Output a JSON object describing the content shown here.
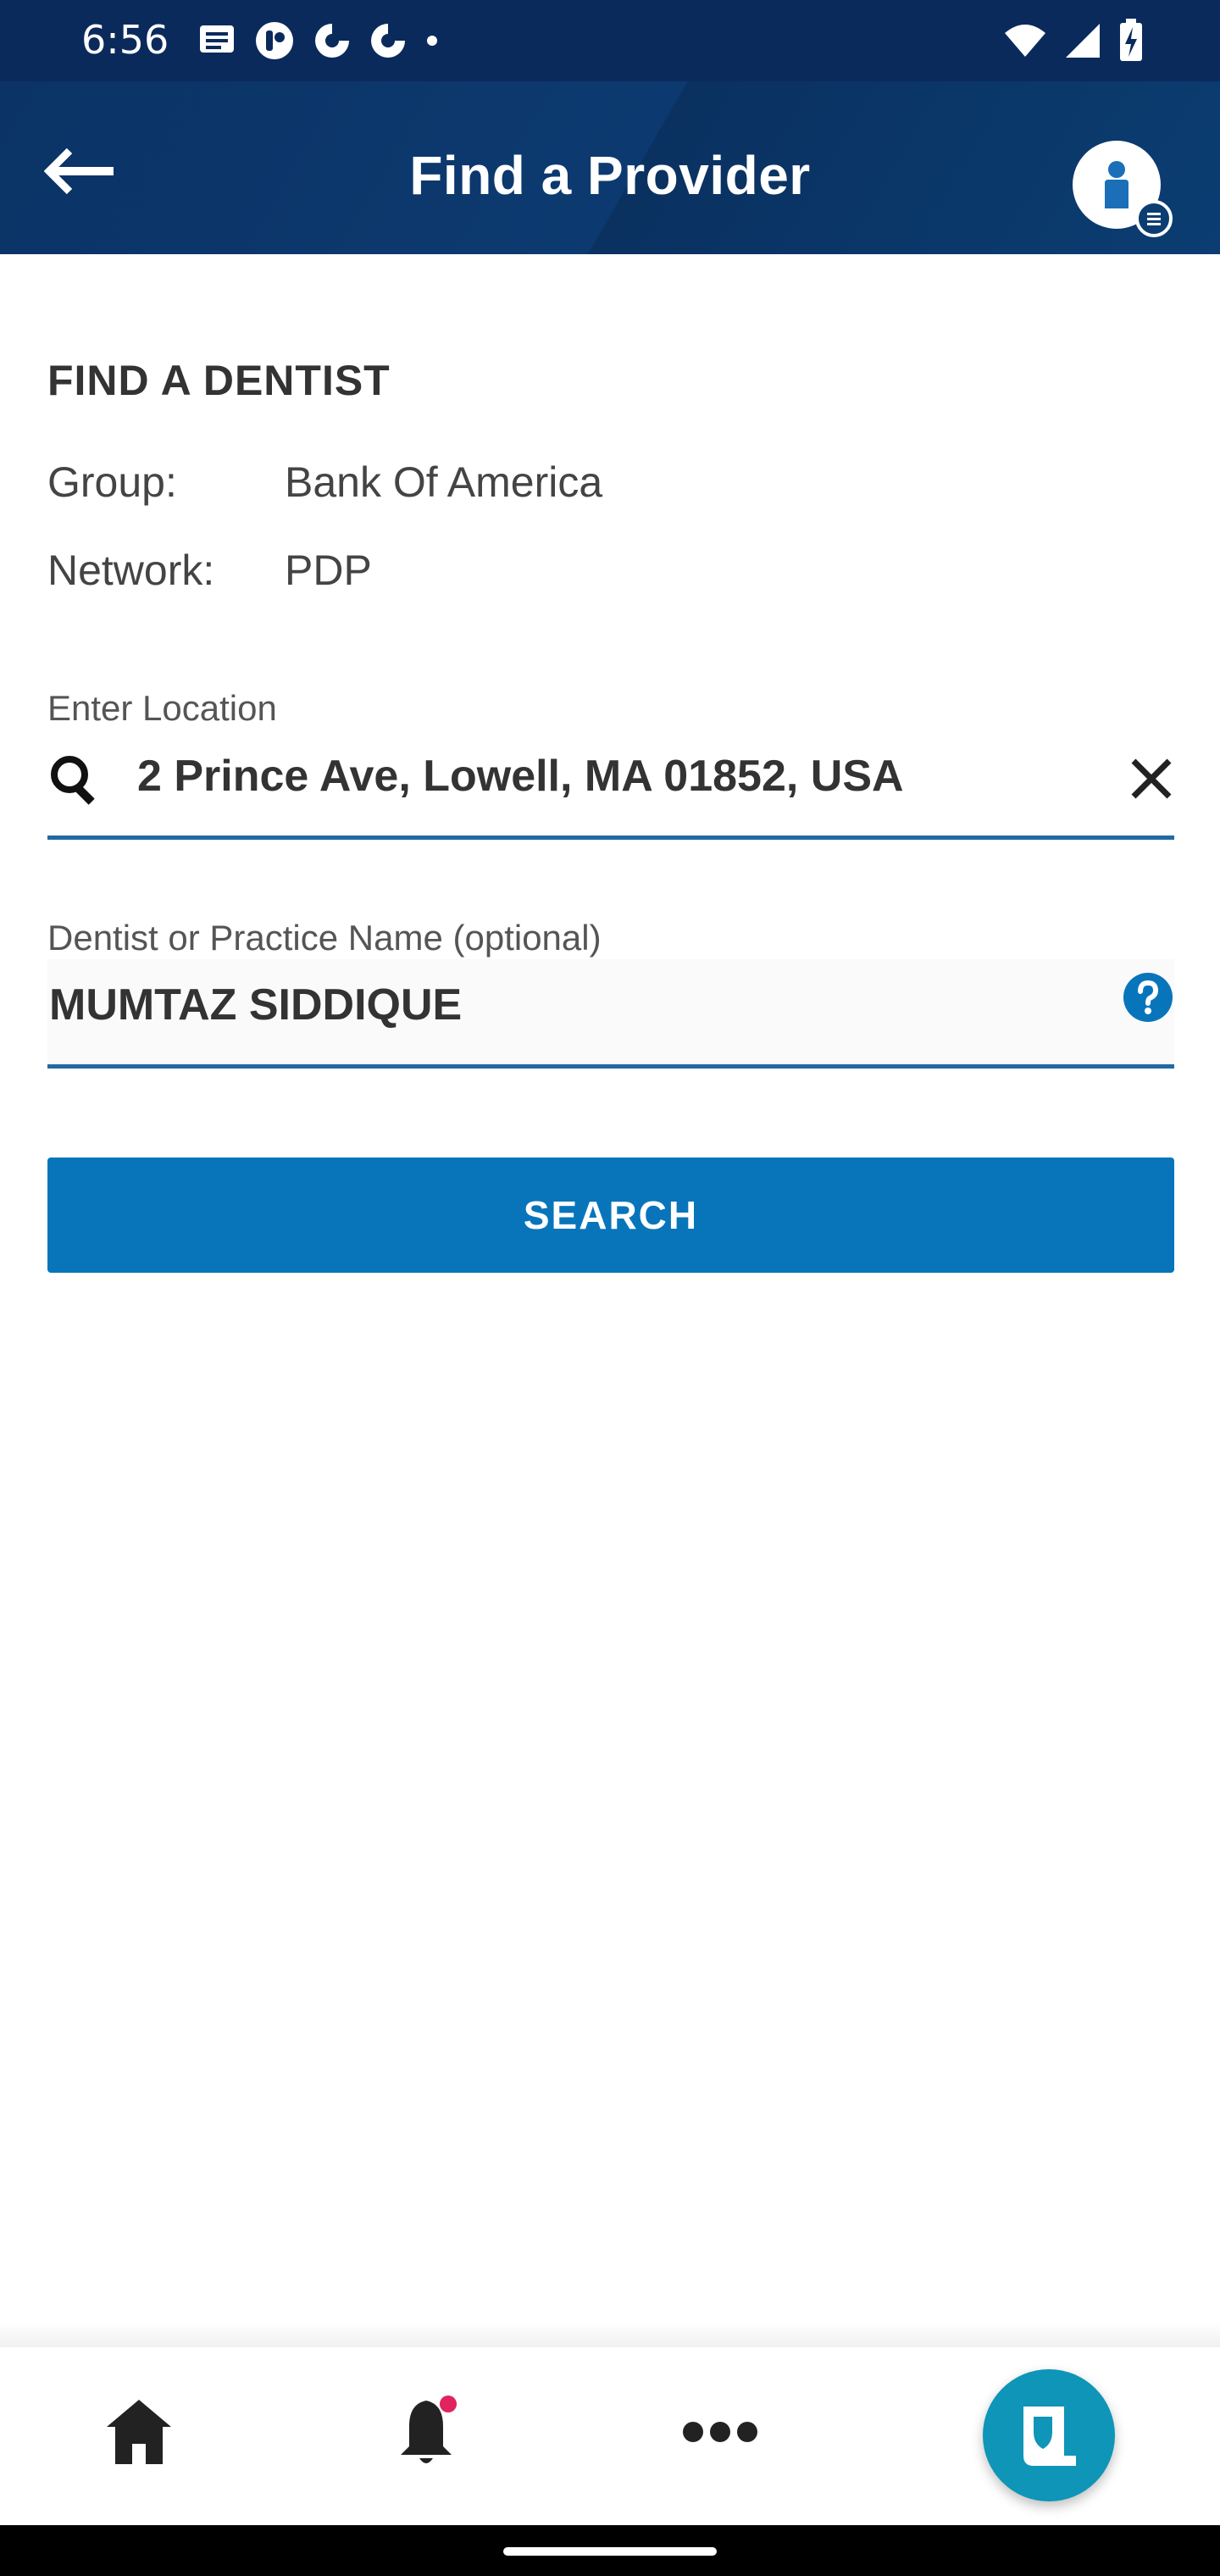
{
  "status_bar": {
    "time": "6:56",
    "left_icons": [
      "message-icon",
      "app-icon",
      "app-icon-2",
      "app-icon-3",
      "dot-icon"
    ],
    "right_icons": [
      "wifi-icon",
      "signal-icon",
      "battery-charging-icon"
    ]
  },
  "app_bar": {
    "title": "Find a Provider",
    "back_icon": "back-arrow-icon",
    "profile_icon": "profile-menu-icon"
  },
  "content": {
    "section_title": "FIND A DENTIST",
    "group": {
      "label": "Group:",
      "value": "Bank Of America"
    },
    "network": {
      "label": "Network:",
      "value": "PDP"
    },
    "location": {
      "label": "Enter Location",
      "value": "2 Prince Ave, Lowell, MA 01852, USA",
      "search_icon": "search-icon",
      "clear_icon": "close-icon"
    },
    "dentist_name": {
      "label": "Dentist or Practice Name (optional)",
      "value": "MUMTAZ SIDDIQUE",
      "help_icon": "help-icon"
    },
    "search_button": "SEARCH"
  },
  "bottom_nav": {
    "items": [
      "home-icon",
      "bell-icon",
      "more-icon",
      "id-card-icon"
    ],
    "notification_dot_color": "#e0245e"
  },
  "colors": {
    "header": "#0b3366",
    "accent": "#0875bb",
    "fab": "#0e95b8"
  }
}
